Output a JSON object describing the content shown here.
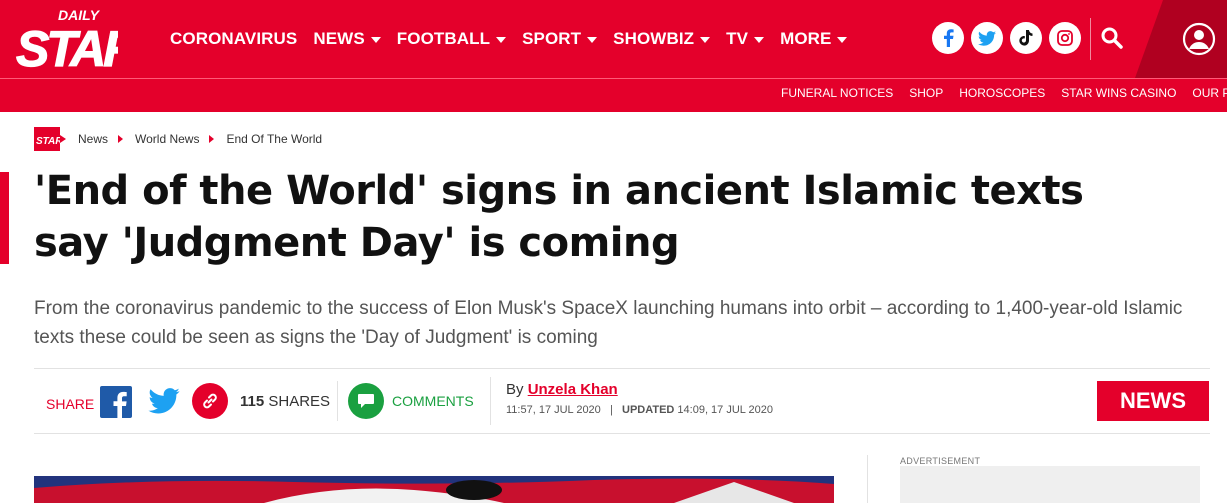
{
  "brand": {
    "logo_top": "DAILY",
    "logo_main": "STAR"
  },
  "main_nav": [
    {
      "label": "CORONAVIRUS",
      "dropdown": false
    },
    {
      "label": "NEWS",
      "dropdown": true
    },
    {
      "label": "FOOTBALL",
      "dropdown": true
    },
    {
      "label": "SPORT",
      "dropdown": true
    },
    {
      "label": "SHOWBIZ",
      "dropdown": true
    },
    {
      "label": "TV",
      "dropdown": true
    },
    {
      "label": "MORE",
      "dropdown": true
    }
  ],
  "social_icons": [
    "facebook-icon",
    "twitter-icon",
    "tiktok-icon",
    "instagram-icon"
  ],
  "sub_nav": [
    "FUNERAL NOTICES",
    "SHOP",
    "HOROSCOPES",
    "STAR WINS CASINO",
    "OUR PAPER"
  ],
  "breadcrumb": {
    "logo_text": "STAR",
    "items": [
      "News",
      "World News",
      "End Of The World"
    ]
  },
  "article": {
    "headline": "'End of the World' signs in ancient Islamic texts say 'Judgment Day' is coming",
    "standfirst": "From the coronavirus pandemic to the success of Elon Musk's SpaceX launching humans into orbit – according to 1,400-year-old Islamic texts these could be seen as signs the 'Day of Judgment' is coming"
  },
  "share": {
    "label": "SHARE",
    "count": "115",
    "count_label": "SHARES",
    "comments_label": "COMMENTS"
  },
  "byline": {
    "prefix": "By",
    "author": "Unzela Khan",
    "published": "11:57, 17 JUL 2020",
    "updated_label": "UPDATED",
    "updated": "14:09, 17 JUL 2020"
  },
  "section_badge": "NEWS",
  "sidebar": {
    "ad_label": "ADVERTISEMENT"
  },
  "colors": {
    "brand_red": "#e4002b",
    "dark_red": "#b00020",
    "comments_green": "#1aa040",
    "facebook_blue": "#1877f2",
    "twitter_blue": "#1da1f2"
  }
}
